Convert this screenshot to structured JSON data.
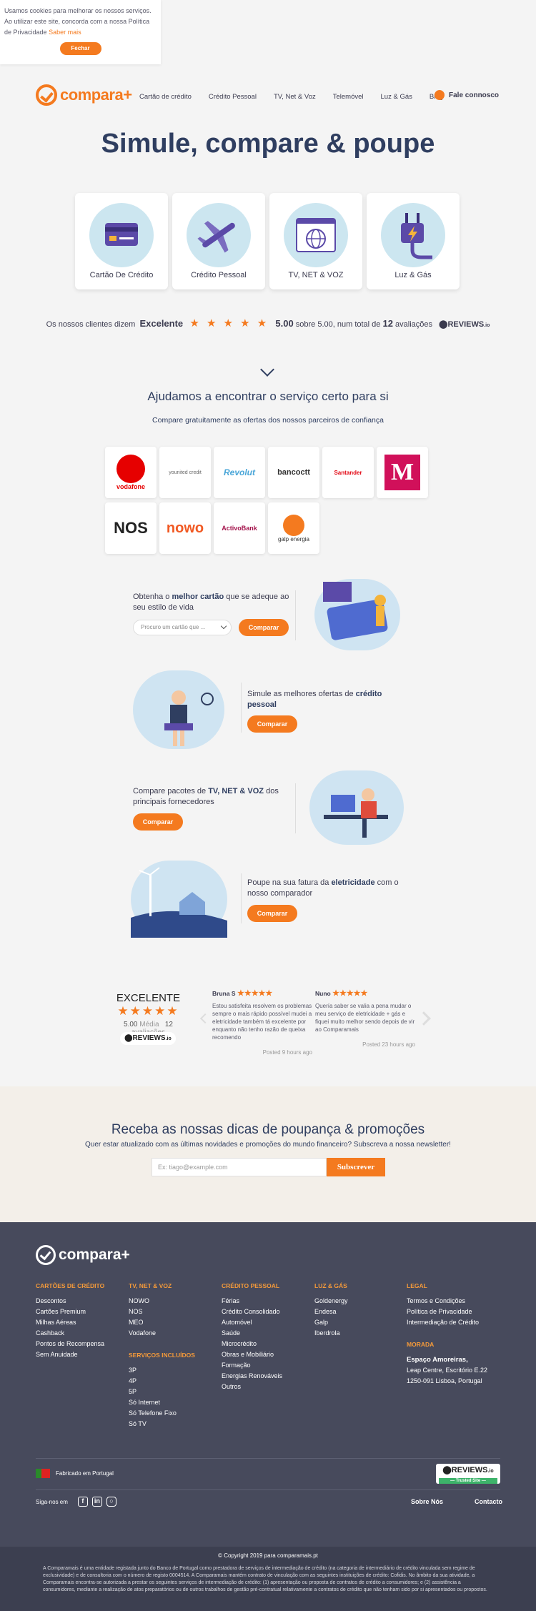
{
  "cookie": {
    "text": "Usamos cookies para melhorar os nossos serviços. Ao utilizar este site, concorda com a nossa Política de Privacidade",
    "link": "Saber mais",
    "button": "Fechar"
  },
  "header": {
    "logo": "compara+",
    "nav": [
      "Cartão de crédito",
      "Crédito Pessoal",
      "TV, Net & Voz",
      "Telemóvel",
      "Luz & Gás",
      "Blog"
    ],
    "contact": "Fale connosco"
  },
  "hero": {
    "title": "Simule, compare & poupe"
  },
  "categories": [
    "Cartão De Crédito",
    "Crédito Pessoal",
    "TV, NET & VOZ",
    "Luz & Gás"
  ],
  "reviews_line": {
    "prefix": "Os nossos clientes dizem",
    "rating_word": "Excelente",
    "stars": "★ ★ ★ ★ ★",
    "score": "5.00",
    "middle": "sobre 5.00, num total de",
    "count": "12",
    "suffix": "avaliações",
    "brand": "REVIEWS",
    "brand_suffix": ".io"
  },
  "help": {
    "title": "Ajudamos a encontrar o serviço certo para si",
    "subtitle": "Compare gratuitamente as ofertas dos nossos parceiros de confiança"
  },
  "partners": [
    "vodafone",
    "younited credit",
    "Revolut",
    "bancoctt",
    "Santander",
    "M",
    "NOS",
    "nowo",
    "ActivoBank",
    "galp energia"
  ],
  "promos": {
    "card": {
      "pre": "Obtenha o",
      "bold": "melhor cartão",
      "post": "que se adeque ao seu estilo de vida",
      "select_placeholder": "Procuro um cartão que ...",
      "button": "Comparar"
    },
    "credit": {
      "pre": "Simule as melhores ofertas de",
      "bold": "crédito pessoal",
      "button": "Comparar"
    },
    "tv": {
      "pre": "Compare pacotes de",
      "bold": "TV, NET & VOZ",
      "post": "dos principais fornecedores",
      "button": "Comparar"
    },
    "energy": {
      "pre": "Poupe na sua fatura da",
      "bold": "eletricidade",
      "post": "com o nosso comparador",
      "button": "Comparar"
    }
  },
  "reviews_widget": {
    "rating_word": "EXCELENTE",
    "stars": "★★★★★",
    "score": "5.00",
    "score_label": "Média",
    "count": "12",
    "count_label": "avaliações",
    "brand": "REVIEWS",
    "brand_suffix": ".io",
    "cards": [
      {
        "name": "Bruna S",
        "stars": "★★★★★",
        "text": "Estou satisfeita resolvem os problemas sempre o mais rápido possível mudei a eletricidade também tá excelente por enquanto não tenho razão de queixa recomendo",
        "posted": "Posted 9 hours ago"
      },
      {
        "name": "Nuno",
        "stars": "★★★★★",
        "text": "Quería saber se valia a pena mudar o meu serviço de eletricidade + gás e fiquei muito melhor sendo depois de vir ao Comparamais",
        "posted": "Posted 23 hours ago"
      }
    ]
  },
  "newsletter": {
    "title": "Receba as nossas dicas de poupança & promoções",
    "subtitle": "Quer estar atualizado com as últimas novidades e promoções do mundo financeiro? Subscreva a nossa newsletter!",
    "placeholder": "Ex: tiago@example.com",
    "button": "Subscrever"
  },
  "footer": {
    "logo": "compara+",
    "cartoes": {
      "title": "CARTÕES DE CRÉDITO",
      "items": [
        "Descontos",
        "Cartões Premium",
        "Milhas Aéreas",
        "Cashback",
        "Pontos de Recompensa",
        "Sem Anuidade"
      ]
    },
    "tv": {
      "title": "TV, NET & VOZ",
      "items": [
        "NOWO",
        "NOS",
        "MEO",
        "Vodafone"
      ]
    },
    "servicos": {
      "title": "SERVIÇOS INCLUÍDOS",
      "items": [
        "3P",
        "4P",
        "5P",
        "Só Internet",
        "Só Telefone Fixo",
        "Só TV"
      ]
    },
    "credito": {
      "title": "CRÉDITO PESSOAL",
      "items": [
        "Férias",
        "Crédito Consolidado",
        "Automóvel",
        "Saúde",
        "Microcrédito",
        "Obras e Mobiliário",
        "Formação",
        "Energias Renováveis",
        "Outros"
      ]
    },
    "luz": {
      "title": "LUZ & GÁS",
      "items": [
        "Goldenergy",
        "Endesa",
        "Galp",
        "Iberdrola"
      ]
    },
    "legal": {
      "title": "LEGAL",
      "items": [
        "Termos e Condições",
        "Política de Privacidade",
        "Intermediação de Crédito"
      ]
    },
    "morada": {
      "title": "MORADA",
      "name": "Espaço Amoreiras,",
      "line1": "Leap Centre, Escritório E.22",
      "line2": "1250-091 Lisboa, Portugal"
    },
    "made_in": "Fabricado em Portugal",
    "badge_brand": "REVIEWS",
    "badge_suffix": ".io",
    "badge_tag": "— Trusted Site —",
    "follow": "Siga-nos em",
    "links": [
      "Sobre Nós",
      "Contacto"
    ],
    "copyright": "© Copyright 2019 para comparamais.pt",
    "disclaimer": "A Comparamais é uma entidade registada junto do Banco de Portugal como prestadora de serviços de intermediação de crédito (na categoria de intermediário de crédito vinculada sem regime de exclusividade) e de consultoria com o número de registo 0004514. A Comparamais mantém contrato de vinculação com as seguintes instituições de crédito: Cofidis. No âmbito da sua atividade, a Comparamais encontra-se autorizada a prestar os seguintes serviços de intermediação de crédito: (1) apresentação ou proposta de contratos de crédito a consumidores; e (2) assistência a consumidores, mediante a realização de atos preparatórios ou de outros trabalhos de gestão pré-contratual relativamente a contratos de crédito que não tenham sido por si apresentados ou propostos."
  }
}
